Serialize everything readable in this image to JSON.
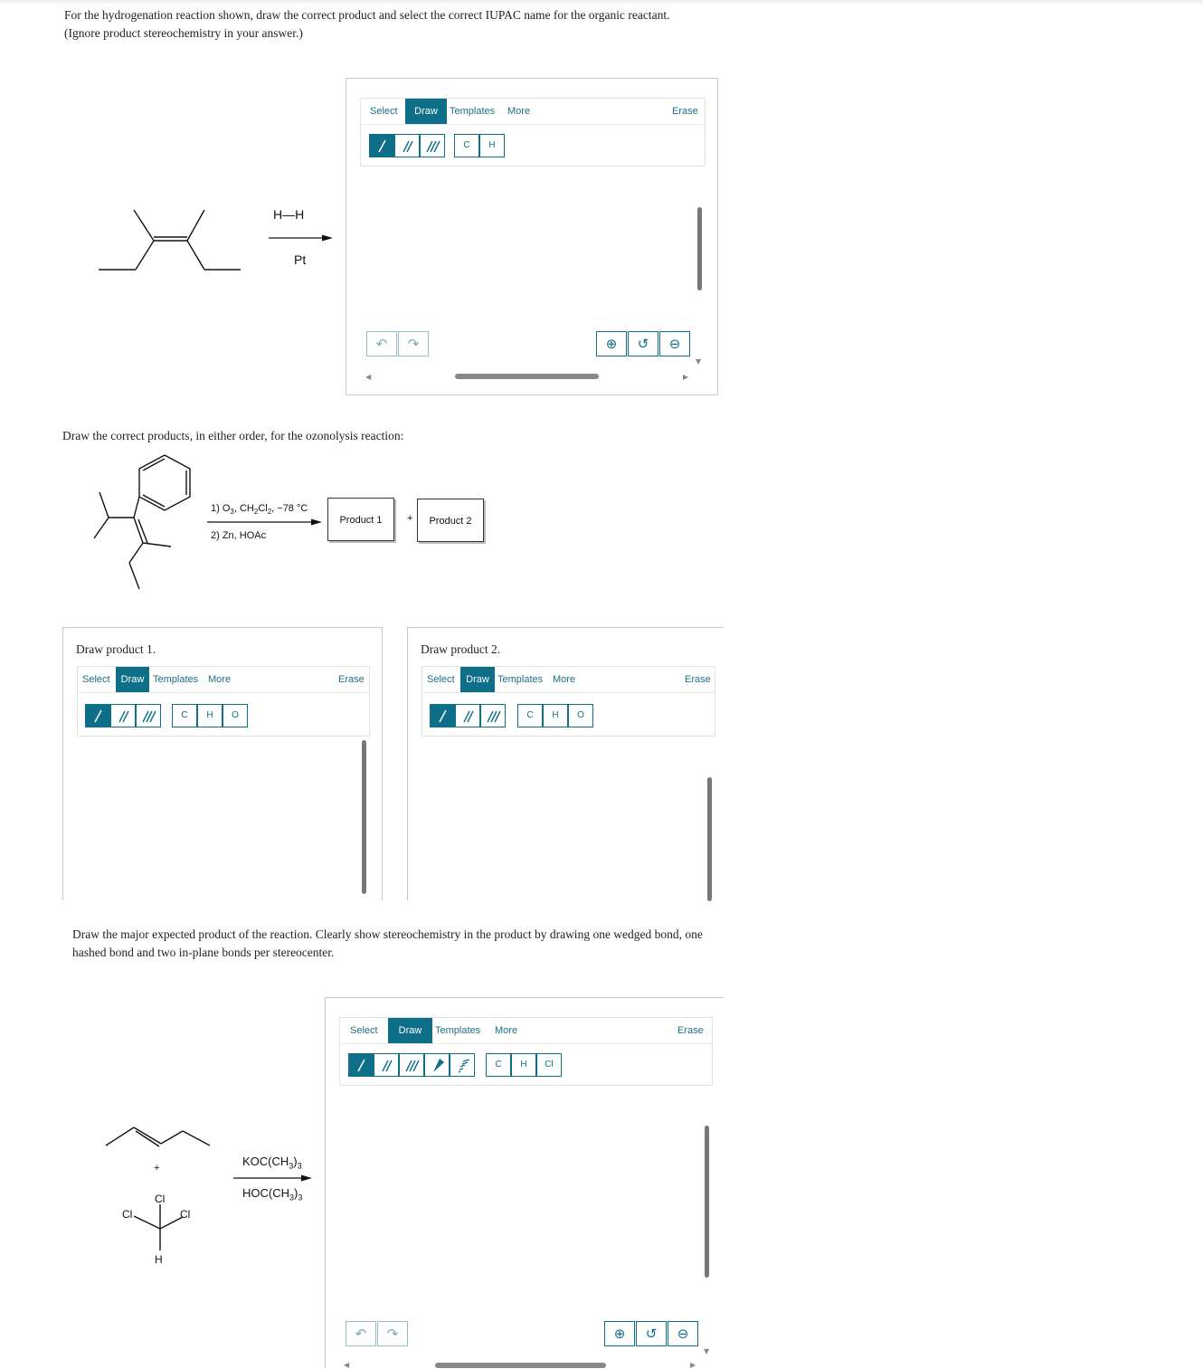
{
  "question1": {
    "prompt_line1": "For the hydrogenation reaction shown, draw the correct product and select the correct IUPAC name for the organic reactant.",
    "prompt_line2": "(Ignore product stereochemistry in your answer.)",
    "reagent_top": "H—H",
    "reagent_bottom": "Pt"
  },
  "sketcher": {
    "tab_select": "Select",
    "tab_draw": "Draw",
    "tab_templates": "Templates",
    "tab_more": "More",
    "erase": "Erase",
    "atom_c": "C",
    "atom_h": "H",
    "atom_o": "O",
    "atom_cl": "Cl"
  },
  "question2": {
    "prompt": "Draw the correct products, in either order, for the ozonolysis reaction:",
    "step1_parts": [
      "1) O",
      "3",
      ", CH",
      "2",
      "Cl",
      "2",
      ", −78 °C"
    ],
    "step2": "2) Zn, HOAc",
    "product1_box": "Product 1",
    "plus": "+",
    "product2_box": "Product 2",
    "panel1_title": "Draw product 1.",
    "panel2_title": "Draw product 2."
  },
  "question3": {
    "prompt_line1": "Draw the major expected product of the reaction. Clearly show stereochemistry in the product by drawing one wedged bond, one",
    "prompt_line2": "hashed bond and two in-plane bonds per stereocenter.",
    "plus": "+",
    "reagent_top_parts": [
      "KOC(CH",
      "3",
      ")",
      "3"
    ],
    "reagent_bottom_parts": [
      "HOC(CH",
      "3",
      ")",
      "3"
    ],
    "atom_labels": {
      "cl_top": "Cl",
      "cl_left": "Cl",
      "cl_right": "Cl",
      "h_bottom": "H"
    }
  },
  "icons": [
    "undo-icon",
    "redo-icon",
    "zoom-in-icon",
    "zoom-reset-icon",
    "zoom-out-icon"
  ],
  "colors": {
    "accent": "#0e6f88",
    "scrollbar": "#777777"
  }
}
